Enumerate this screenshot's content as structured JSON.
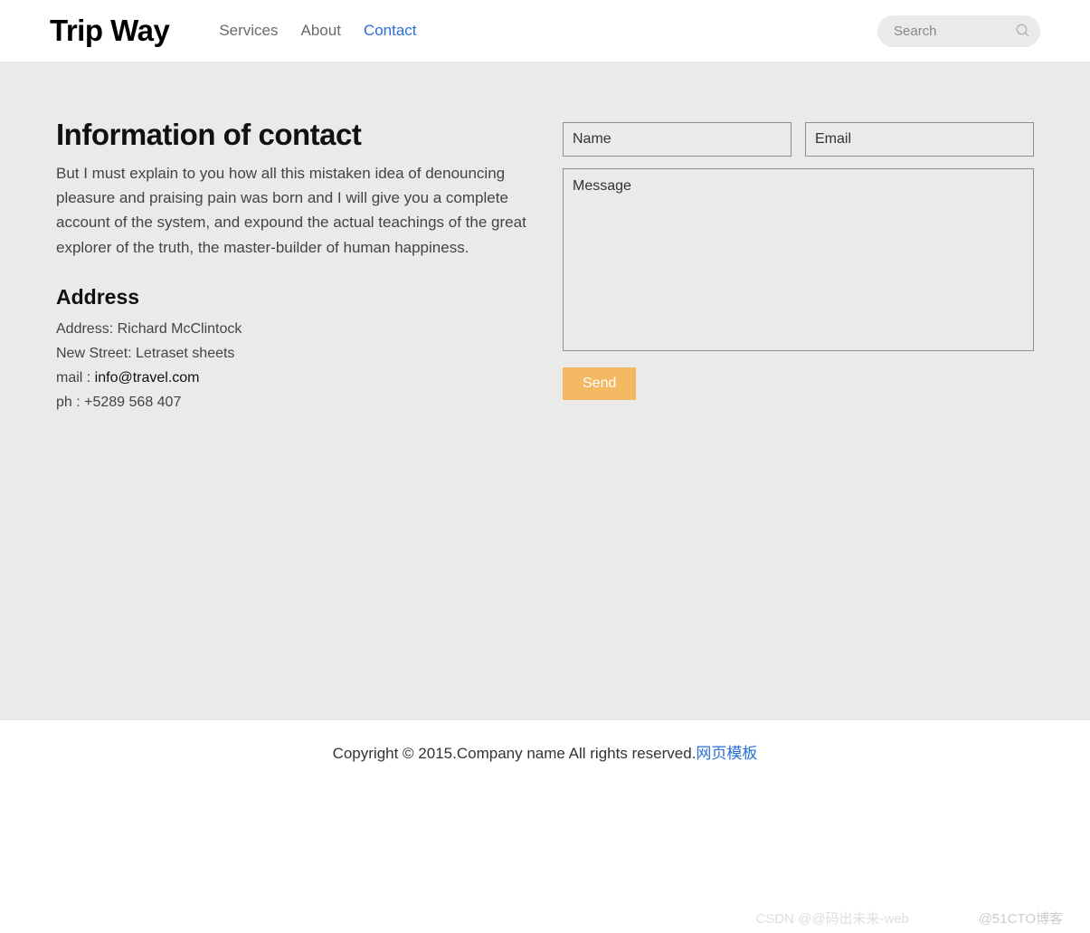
{
  "header": {
    "logo": "Trip Way",
    "nav": {
      "services": "Services",
      "about": "About",
      "contact": "Contact"
    },
    "search_placeholder": "Search"
  },
  "contact": {
    "title": "Information of contact",
    "description": "But I must explain to you how all this mistaken idea of denouncing pleasure and praising pain was born and I will give you a complete account of the system, and expound the actual teachings of the great explorer of the truth, the master-builder of human happiness.",
    "address_heading": "Address",
    "addr_line1": "Address: Richard McClintock",
    "addr_line2": "New Street: Letraset sheets",
    "mail_prefix": "mail : ",
    "mail_link": "info@travel.com",
    "phone": "ph : +5289 568 407"
  },
  "form": {
    "name_placeholder": "Name",
    "email_placeholder": "Email",
    "message_placeholder": "Message",
    "send_label": "Send"
  },
  "footer": {
    "copyright": "Copyright © 2015.Company name All rights reserved.",
    "link_text": "网页模板"
  },
  "watermark": {
    "w1": "CSDN @@码出未来-web",
    "w2": "@51CTO博客"
  }
}
